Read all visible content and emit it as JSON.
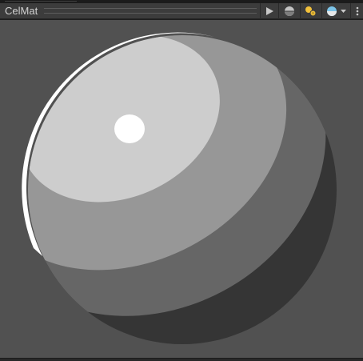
{
  "window": {
    "title": "CelMat"
  },
  "toolbar": {
    "buttons": [
      {
        "name": "play",
        "icon": "play-icon"
      },
      {
        "name": "preview-shape",
        "icon": "sphere-icon"
      },
      {
        "name": "lights",
        "icon": "lights-icon"
      },
      {
        "name": "preview-background",
        "icon": "skydome-icon"
      },
      {
        "name": "more",
        "icon": "kebab-menu-icon"
      }
    ]
  },
  "preview": {
    "background_color": "#515151",
    "shading_bands": [
      "#cdcdcd",
      "#979797",
      "#666666",
      "#353535"
    ],
    "rim_light_color": "#ffffff",
    "specular_color": "#ffffff"
  }
}
